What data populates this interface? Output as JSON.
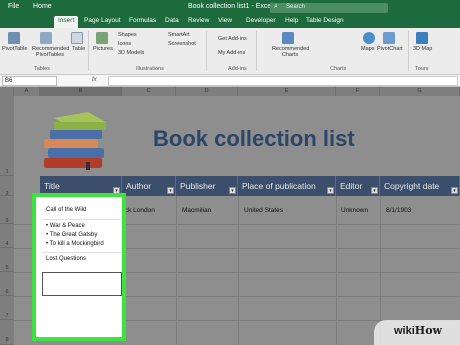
{
  "window": {
    "quick_access": [
      "File",
      "Home"
    ],
    "title": "Book collection list1 - Excel",
    "search_placeholder": "Search"
  },
  "tabs": [
    "Insert",
    "Page Layout",
    "Formulas",
    "Data",
    "Review",
    "View",
    "Developer",
    "Help",
    "Table Design"
  ],
  "active_tab": "Insert",
  "ribbon": {
    "groups": [
      {
        "label": "Tables",
        "items": [
          "PivotTable",
          "Recommended PivotTables",
          "Table"
        ]
      },
      {
        "label": "Illustrations",
        "items": [
          "Pictures",
          "Shapes",
          "Icons",
          "3D Models",
          "SmartArt",
          "Screenshot"
        ]
      },
      {
        "label": "Add-ins",
        "items": [
          "Get Add-ins",
          "My Add-ins"
        ]
      },
      {
        "label": "Charts",
        "items": [
          "Recommended Charts",
          "Maps",
          "PivotChart"
        ]
      },
      {
        "label": "Tours",
        "items": [
          "3D Map"
        ]
      }
    ]
  },
  "formula_bar": {
    "name_box": "B6",
    "fx": "fx",
    "value": ""
  },
  "columns": [
    "A",
    "B",
    "C",
    "D",
    "E",
    "F",
    "G"
  ],
  "rows": [
    "1",
    "2",
    "3",
    "4",
    "5",
    "6",
    "7",
    "8"
  ],
  "sheet_title": "Book collection list",
  "table": {
    "headers": [
      "Title",
      "Author",
      "Publisher",
      "Place of publication",
      "Editor",
      "Copyright date"
    ],
    "row1": {
      "author": "Jack London",
      "publisher": "Macmilian",
      "place": "United States",
      "editor": "Unknown",
      "date": "8/1/1903"
    }
  },
  "b_column": {
    "item1": "Call of the Wild",
    "list": [
      "• War & Peace",
      "• The Great Gatsby",
      "• To kill a Mockingbird"
    ],
    "item2": "Lost Questions"
  },
  "watermark": {
    "wiki": "wiki",
    "how": "How"
  },
  "colors": {
    "excel_green": "#1d6b3c",
    "highlight": "#3fe33f",
    "header_bg": "#3b4f6d",
    "title_color": "#2c456a"
  }
}
